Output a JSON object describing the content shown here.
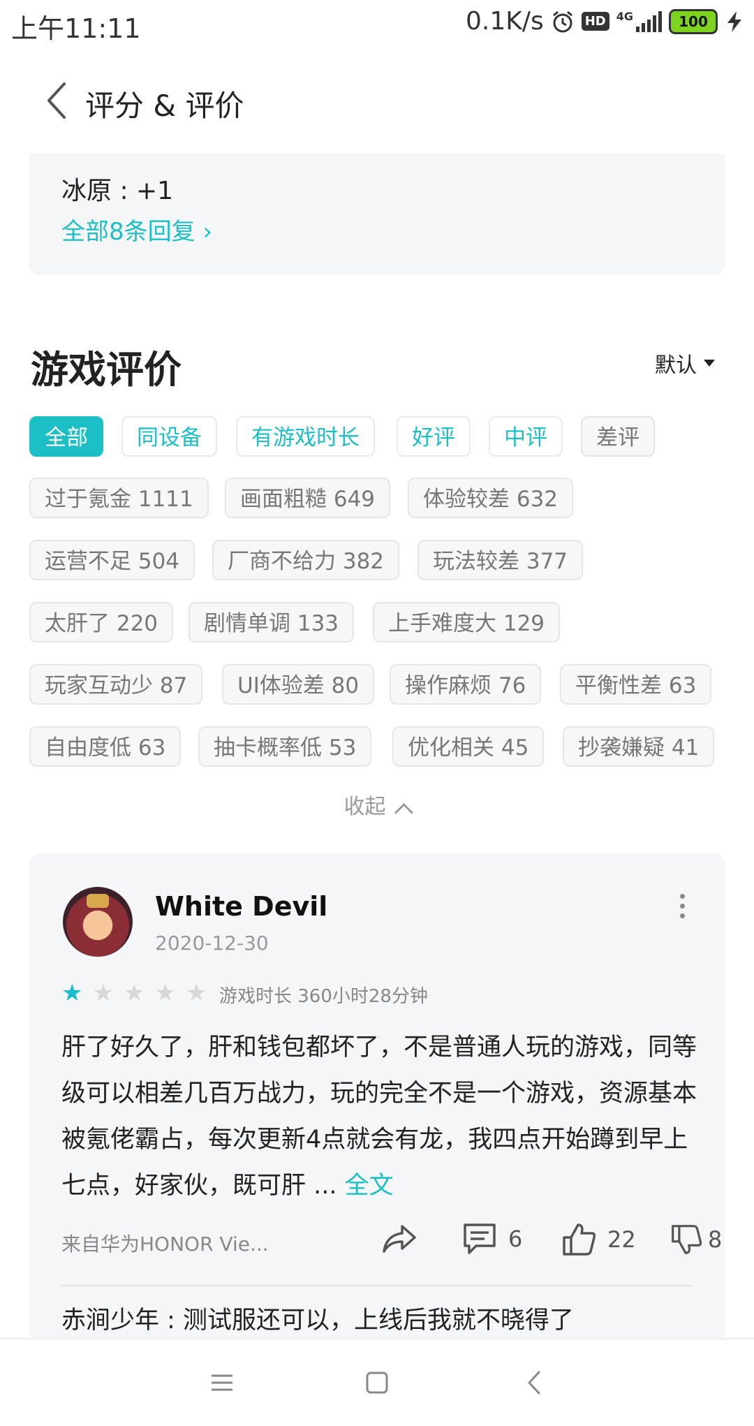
{
  "status_bar": {
    "time": "上午11:11",
    "net_speed": "0.1K/s",
    "hd": "HD",
    "network": "4G",
    "battery": "100"
  },
  "header": {
    "title": "评分 & 评价"
  },
  "reply_card": {
    "line": "冰原 : +1",
    "link": "全部8条回复 ›"
  },
  "section": {
    "title": "游戏评价",
    "sort_label": "默认"
  },
  "filters": [
    "全部",
    "同设备",
    "有游戏时长",
    "好评",
    "中评",
    "差评"
  ],
  "tags": [
    "过于氪金 1111",
    "画面粗糙 649",
    "体验较差 632",
    "运营不足 504",
    "厂商不给力 382",
    "玩法较差 377",
    "太肝了 220",
    "剧情单调 133",
    "上手难度大 129",
    "玩家互动少 87",
    "UI体验差 80",
    "操作麻烦 76",
    "平衡性差 63",
    "自由度低 63",
    "抽卡概率低 53",
    "优化相关 45",
    "抄袭嫌疑 41"
  ],
  "collapse_label": "收起",
  "review": {
    "username": "White Devil",
    "date": "2020-12-30",
    "rating": 1,
    "rating_max": 5,
    "playtime": "游戏时长 360小时28分钟",
    "content": "肝了好久了，肝和钱包都坏了，不是普通人玩的游戏，同等级可以相差几百万战力，玩的完全不是一个游戏，资源基本被氪佬霸占，每次更新4点就会有龙，我四点开始蹲到早上七点，好家伙，既可肝 ... ",
    "full_text_link": "全文",
    "device": "来自华为HONOR Vie...",
    "comments": "6",
    "likes": "22",
    "dislikes": "8",
    "sub_reply": "赤涧少年 : 测试服还可以，上线后我就不晓得了"
  },
  "colors": {
    "accent": "#1dbfc6",
    "card_bg": "#f5f6f8"
  }
}
